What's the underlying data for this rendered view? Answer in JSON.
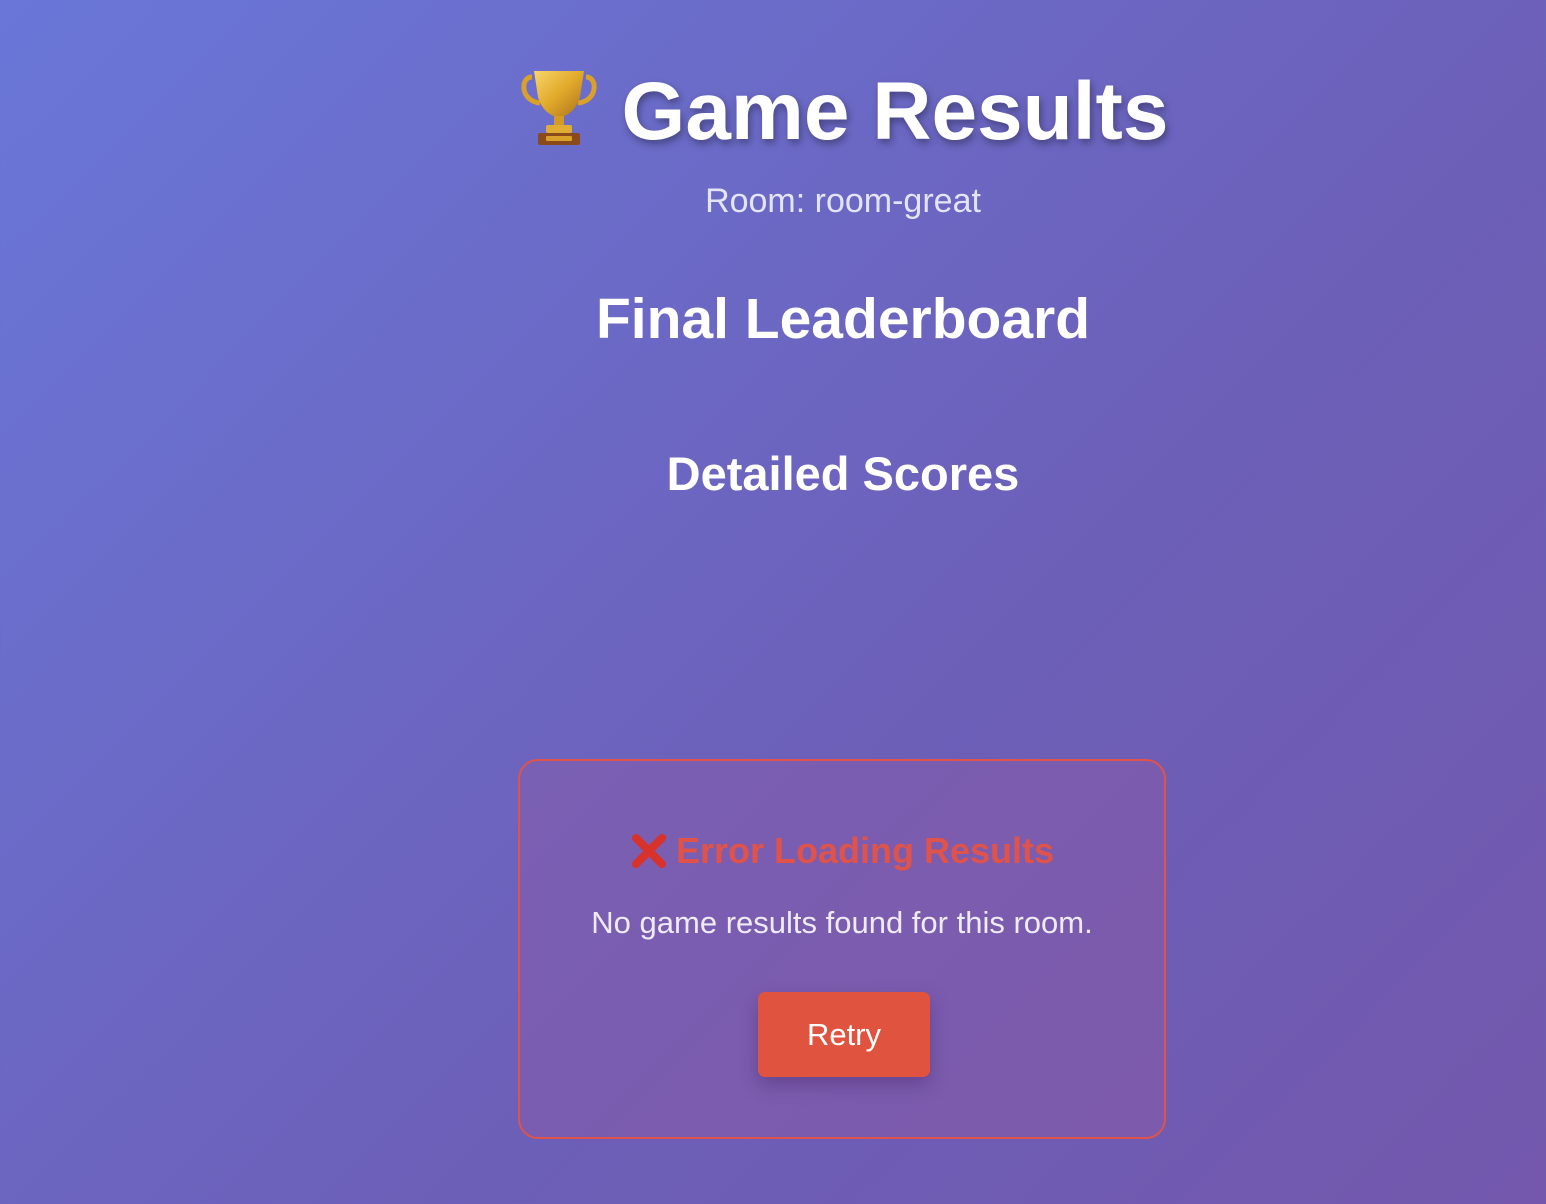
{
  "header": {
    "title": "Game Results",
    "trophy_icon": "trophy-icon",
    "room_label": "Room: room-great"
  },
  "sections": {
    "leaderboard_heading": "Final Leaderboard",
    "scores_heading": "Detailed Scores"
  },
  "error": {
    "icon": "x-icon",
    "title": "Error Loading Results",
    "message": "No game results found for this room.",
    "retry_label": "Retry"
  },
  "colors": {
    "background_start": "#6a77d8",
    "background_end": "#7358ad",
    "error_accent": "#e0534a",
    "retry_button": "#e0533f"
  }
}
